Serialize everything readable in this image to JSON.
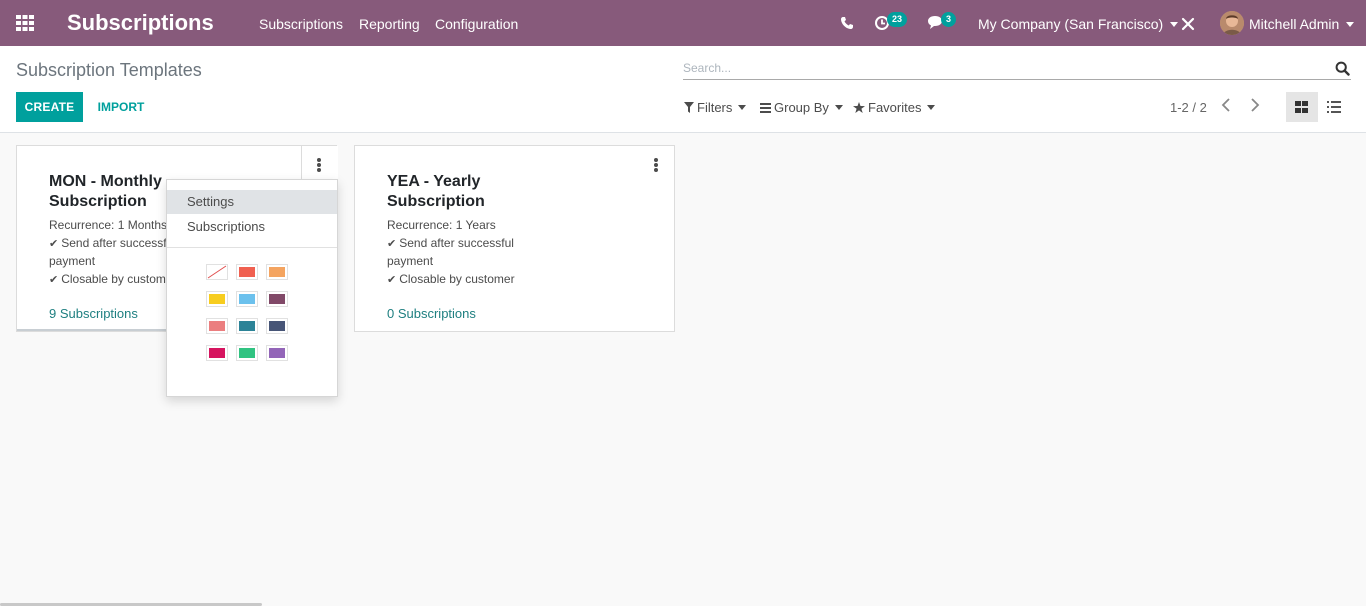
{
  "navbar": {
    "app_title": "Subscriptions",
    "menu": [
      "Subscriptions",
      "Reporting",
      "Configuration"
    ],
    "activity_badge": "23",
    "messages_badge": "3",
    "company": "My Company (San Francisco)",
    "user_name": "Mitchell Admin",
    "icons": [
      "apps-grid-icon",
      "phone-icon",
      "activity-clock-icon",
      "chat-icon",
      "debug-tools-icon",
      "user-avatar"
    ]
  },
  "control_panel": {
    "breadcrumb": "Subscription Templates",
    "search_placeholder": "Search...",
    "create_label": "CREATE",
    "import_label": "IMPORT",
    "filters_label": "Filters",
    "group_by_label": "Group By",
    "favorites_label": "Favorites",
    "pager": "1-2 / 2",
    "active_view": "kanban"
  },
  "cards": [
    {
      "title": "MON - Monthly Subscription",
      "recurrence": "Recurrence: 1 Months",
      "send_after": "Send after successful",
      "send_after_2": "payment",
      "closable": "Closable by customer",
      "link": "9 Subscriptions"
    },
    {
      "title": "YEA - Yearly Subscription",
      "recurrence": "Recurrence: 1 Years",
      "send_after": "Send after successful",
      "send_after_2": "payment",
      "closable": "Closable by customer",
      "link": "0 Subscriptions"
    }
  ],
  "card_menu": {
    "items": [
      "Settings",
      "Subscriptions"
    ],
    "hovered": "Settings",
    "colors": [
      "none",
      "#f06050",
      "#f4a460",
      "#f7cd1f",
      "#6cc1ed",
      "#814968",
      "#eb7e7f",
      "#2c8397",
      "#475577",
      "#d6145f",
      "#30c381",
      "#9365b8"
    ]
  },
  "theme": {
    "navbar_bg": "#875a7b",
    "primary": "#00a09d",
    "link": "#1e7f80"
  }
}
